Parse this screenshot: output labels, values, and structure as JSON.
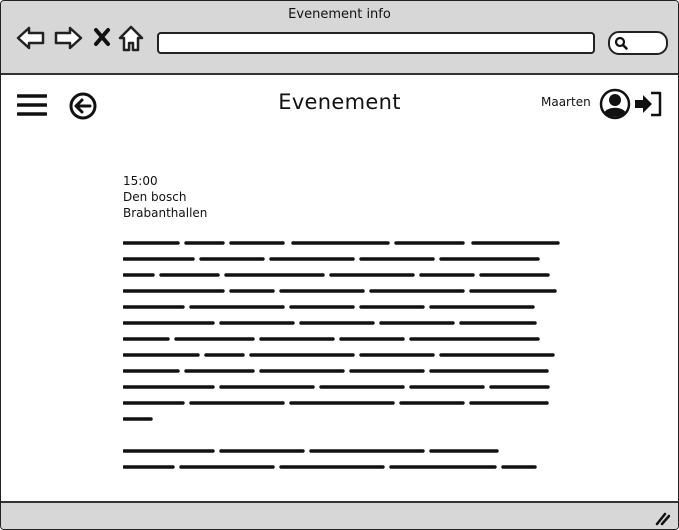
{
  "window": {
    "title": "Evenement info"
  },
  "browser": {
    "icons": [
      "back-arrow-icon",
      "forward-arrow-icon",
      "close-icon",
      "home-icon",
      "search-icon"
    ],
    "url": ""
  },
  "app": {
    "title": "Evenement",
    "user": {
      "name": "Maarten"
    },
    "icons": [
      "hamburger-menu-icon",
      "back-circle-icon",
      "user-avatar-icon",
      "login-icon"
    ]
  },
  "event": {
    "time": "15:00",
    "city": "Den bosch",
    "venue": "Brabanthallen"
  },
  "colors": {
    "chrome": "#d7d7d7",
    "stroke": "#222222",
    "background": "#ffffff"
  }
}
